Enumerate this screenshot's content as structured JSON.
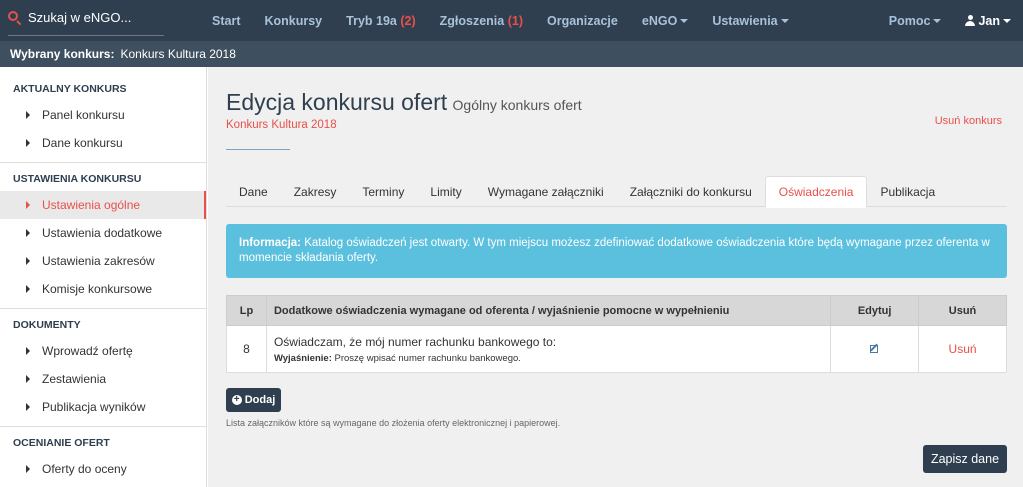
{
  "search": {
    "label": "Szukaj w eNGO..."
  },
  "nav": {
    "start": "Start",
    "konkursy": "Konkursy",
    "tryb": "Tryb 19a",
    "tryb_count": "(2)",
    "zgloszenia": "Zgłoszenia",
    "zgloszenia_count": "(1)",
    "organizacje": "Organizacje",
    "engo": "eNGO",
    "ustawienia": "Ustawienia",
    "pomoc": "Pomoc",
    "user": "Jan"
  },
  "selected": {
    "label": "Wybrany konkurs:",
    "value": "Konkurs Kultura 2018"
  },
  "sidebar": {
    "sections": [
      {
        "title": "AKTUALNY KONKURS",
        "items": [
          "Panel konkursu",
          "Dane konkursu"
        ]
      },
      {
        "title": "USTAWIENIA KONKURSU",
        "items": [
          "Ustawienia ogólne",
          "Ustawienia dodatkowe",
          "Ustawienia zakresów",
          "Komisje konkursowe"
        ]
      },
      {
        "title": "DOKUMENTY",
        "items": [
          "Wprowadź ofertę",
          "Zestawienia",
          "Publikacja wyników"
        ]
      },
      {
        "title": "OCENIANIE OFERT",
        "items": [
          "Oferty do oceny"
        ]
      }
    ]
  },
  "page": {
    "title": "Edycja konkursu ofert",
    "subtitle": "Ogólny konkurs ofert",
    "contest": "Konkurs Kultura 2018",
    "delete": "Usuń konkurs"
  },
  "tabs": [
    "Dane",
    "Zakresy",
    "Terminy",
    "Limity",
    "Wymagane załączniki",
    "Załączniki do konkursu",
    "Oświadczenia",
    "Publikacja"
  ],
  "info": {
    "label": "Informacja:",
    "text": "Katalog oświadczeń jest otwarty. W tym miejscu możesz zdefiniować dodatkowe oświadczenia które będą wymagane przez oferenta w momencie składania oferty."
  },
  "table": {
    "headers": {
      "lp": "Lp",
      "desc": "Dodatkowe oświadczenia wymagane od oferenta / wyjaśnienie pomocne w wypełnieniu",
      "edit": "Edytuj",
      "delete": "Usuń"
    },
    "rows": [
      {
        "lp": "8",
        "statement": "Oświadczam, że mój numer rachunku bankowego to:",
        "expl_label": "Wyjaśnienie:",
        "expl_text": "Proszę wpisać numer rachunku bankowego.",
        "delete": "Usuń"
      }
    ]
  },
  "actions": {
    "add": "Dodaj",
    "hint": "Lista załączników które są wymagane do złożenia oferty elektronicznej i papierowej.",
    "save": "Zapisz dane"
  }
}
